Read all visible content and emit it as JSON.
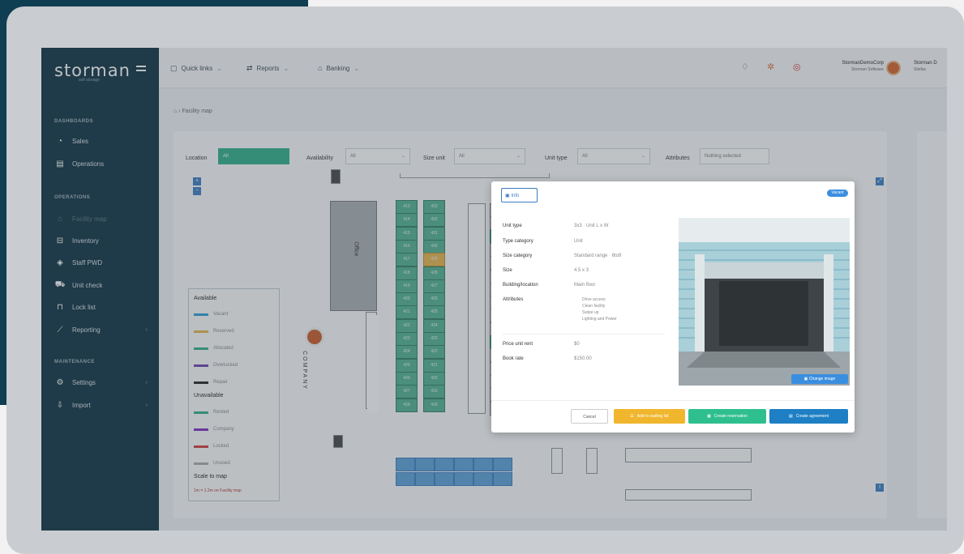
{
  "app": {
    "logo": "storman",
    "logo_sub": "self storage"
  },
  "sidebar": {
    "sections": [
      {
        "title": "DASHBOARDS",
        "items": [
          {
            "label": "Sales",
            "icon": "chart-icon"
          },
          {
            "label": "Operations",
            "icon": "building-icon"
          }
        ]
      },
      {
        "title": "OPERATIONS",
        "items": [
          {
            "label": "Facility map",
            "icon": "map-icon",
            "active": true
          },
          {
            "label": "Inventory",
            "icon": "box-icon"
          },
          {
            "label": "Staff PWD",
            "icon": "shield-icon"
          },
          {
            "label": "Unit check",
            "icon": "car-icon"
          },
          {
            "label": "Lock list",
            "icon": "lock-icon"
          },
          {
            "label": "Reporting",
            "icon": "reporting-icon",
            "has_children": true
          }
        ]
      },
      {
        "title": "MAINTENANCE",
        "items": [
          {
            "label": "Settings",
            "icon": "gear-icon",
            "has_children": true
          },
          {
            "label": "Import",
            "icon": "import-icon",
            "has_children": true
          }
        ]
      }
    ]
  },
  "topbar": {
    "menus": [
      {
        "label": "Quick links",
        "icon": "link-icon"
      },
      {
        "label": "Reports",
        "icon": "reports-icon"
      },
      {
        "label": "Banking",
        "icon": "bank-icon"
      }
    ],
    "user1": {
      "name": "StormanDemoCorp",
      "role": "Storman Software"
    },
    "user2": {
      "name": "Storman D",
      "role": "Sitefac"
    }
  },
  "breadcrumb": "Facility map",
  "filters": {
    "location": {
      "label": "Location",
      "value": "All"
    },
    "availability": {
      "label": "Availability",
      "value": "All"
    },
    "size_unit": {
      "label": "Size unit",
      "value": "All"
    },
    "unit_type": {
      "label": "Unit type",
      "value": "All"
    },
    "attributes": {
      "label": "Attributes",
      "value": "Nothing selected"
    }
  },
  "legend": {
    "available_title": "Available",
    "available": [
      {
        "label": "Vacant",
        "color": "#2b9bd6"
      },
      {
        "label": "Reserved",
        "color": "#e6b24a"
      },
      {
        "label": "Allocated",
        "color": "#2fae87"
      },
      {
        "label": "Overlocked",
        "color": "#6a3fb0"
      },
      {
        "label": "Repair",
        "color": "#222222"
      }
    ],
    "unavailable_title": "Unavailable",
    "unavailable": [
      {
        "label": "Rented",
        "color": "#2fae87"
      },
      {
        "label": "Company",
        "color": "#7a2fc0"
      },
      {
        "label": "Locked",
        "color": "#d23a3a"
      },
      {
        "label": "Unused",
        "color": "#aaaaaa"
      }
    ],
    "scale_title": "Scale to map",
    "scale_text": "1m = 1.2m on Facility map"
  },
  "map": {
    "office_label": "Office",
    "company_label": "COMPANY",
    "column1": [
      "413",
      "414",
      "415",
      "416",
      "417",
      "418",
      "419",
      "420",
      "421",
      "422",
      "423",
      "424",
      "425",
      "426",
      "427",
      "428"
    ],
    "column2": [
      "433",
      "432",
      "431",
      "430",
      "429",
      "428",
      "427",
      "426",
      "425",
      "424",
      "423",
      "422",
      "421",
      "420",
      "419",
      "418"
    ]
  },
  "modal": {
    "tab_label": "Info",
    "badge": "Vacant",
    "rows": [
      {
        "k": "Unit type",
        "v": "3x3 · Unit L x W"
      },
      {
        "k": "Type category",
        "v": "Unit"
      },
      {
        "k": "Size category",
        "v": "Standard range · 6to9"
      },
      {
        "k": "Size",
        "v": "4.5 x 3"
      },
      {
        "k": "Building/location",
        "v": "Main floor"
      },
      {
        "k": "Attributes",
        "v": ""
      }
    ],
    "attributes": [
      "Drive access",
      "Clean facility",
      "Swipe up",
      "Lighting and Power"
    ],
    "rows2": [
      {
        "k": "Price unit rent",
        "v": "$0"
      },
      {
        "k": "Book rate",
        "v": "$150.00"
      }
    ],
    "photo_button": "Change image",
    "buttons": {
      "cancel": "Cancel",
      "waitlist": "Add to waiting list",
      "reservation": "Create reservation",
      "agreement": "Create agreement"
    }
  }
}
